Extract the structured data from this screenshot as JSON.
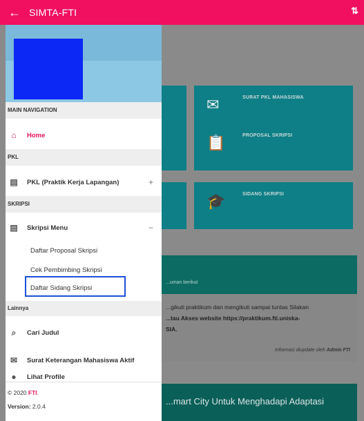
{
  "appbar": {
    "back_icon": "arrow-left-icon",
    "title": "SIMTA-FTI",
    "sort_icon": "sort-arrows-icon",
    "color": "#f0105f"
  },
  "background": {
    "tiles": [
      {
        "label": "SURAT PKL MAHASISWA",
        "icon": "mail-icon"
      },
      {
        "label": "PROPOSAL SKRIPSI",
        "icon": "clipboard-icon"
      },
      {
        "label": "SIDANG SKRIPSI",
        "icon": "graduation-cap-icon"
      }
    ],
    "panel_header_text": "...uman berikut",
    "panel_lines": [
      "...gikuti praktikum dan mengikuti sampai tuntas Silakan",
      "...tau Akses website https://praktikum.fti.uniska-",
      "SIA."
    ],
    "panel_note_prefix": "Informasi diupdate oleh",
    "panel_note_author": "Admin FTI",
    "panel2_text": "...mart City Untuk Menghadapi Adaptasi",
    "tile_color": "#0e7f86"
  },
  "drawer": {
    "avatar_color": "#0b28f5",
    "sections": {
      "main": "MAIN NAVIGATION",
      "pkl": "PKL",
      "skripsi": "SKRIPSI",
      "lainnya": "Lainnya"
    },
    "items": {
      "home": "Home",
      "pkl": "PKL (Praktik Kerja Lapangan)",
      "pkl_toggle": "+",
      "skripsi": "Skripsi Menu",
      "skripsi_toggle": "−",
      "cari_judul": "Cari Judul",
      "surat": "Surat Keterangan Mahasiswa Aktif",
      "lihat_profile": "Lihat Profile"
    },
    "subitems": [
      "Daftar Proposal Skripsi",
      "Cek Pembimbing Skripsi",
      "Daftar Sidang Skripsi"
    ],
    "footer": {
      "copyright_prefix": "© 2020",
      "brand": "FTI",
      "brand_suffix": ".",
      "version_label": "Version:",
      "version_value": "2.0.4"
    },
    "accent_color": "#e31458",
    "highlight_color": "#1a4fd8"
  }
}
